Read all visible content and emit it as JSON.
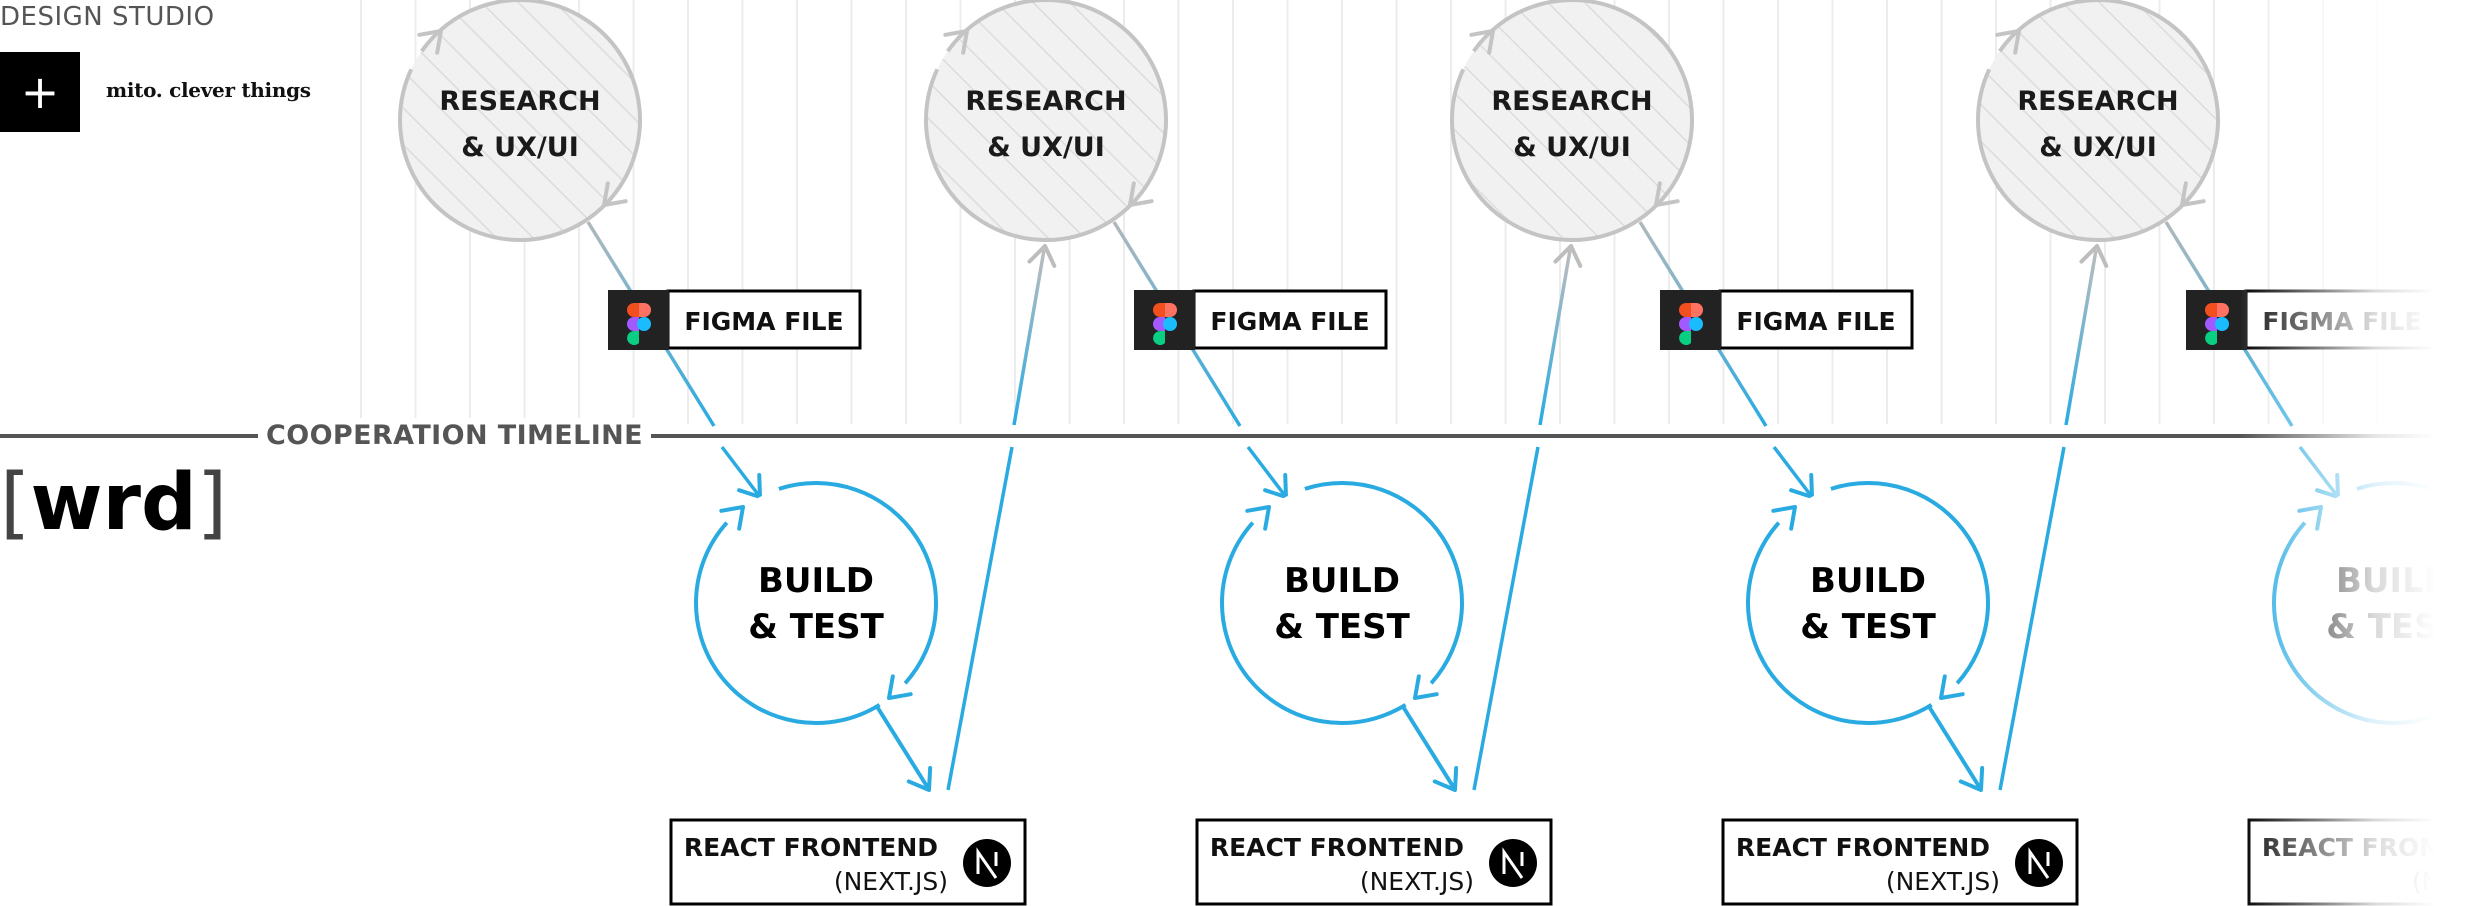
{
  "header": {
    "studio_label": "DESIGN STUDIO",
    "logo_icon": "plus-icon",
    "studio_name": "mito. clever things"
  },
  "client": {
    "bracket_left": "[",
    "name": "wrd",
    "bracket_right": "]"
  },
  "timeline": {
    "label": "COOPERATION TIMELINE",
    "arrow_icon": "arrow-right-icon"
  },
  "colors": {
    "research_stroke": "#c4c4c4",
    "research_fill": "#f1f1f1",
    "build_stroke": "#29abe2",
    "timeline": "#555555",
    "text_dark": "#1a1a1a"
  },
  "cycles": [
    {
      "research": {
        "line1": "RESEARCH",
        "line2": "& UX/UI"
      },
      "figma": {
        "label": "FIGMA FILE",
        "icon": "figma-icon"
      },
      "build": {
        "line1": "BUILD",
        "line2": "& TEST"
      },
      "react": {
        "line1": "REACT FRONTEND",
        "line2": "(NEXT.JS)",
        "icon": "nextjs-icon"
      }
    },
    {
      "research": {
        "line1": "RESEARCH",
        "line2": "& UX/UI"
      },
      "figma": {
        "label": "FIGMA FILE",
        "icon": "figma-icon"
      },
      "build": {
        "line1": "BUILD",
        "line2": "& TEST"
      },
      "react": {
        "line1": "REACT FRONTEND",
        "line2": "(NEXT.JS)",
        "icon": "nextjs-icon"
      }
    },
    {
      "research": {
        "line1": "RESEARCH",
        "line2": "& UX/UI"
      },
      "figma": {
        "label": "FIGMA FILE",
        "icon": "figma-icon"
      },
      "build": {
        "line1": "BUILD",
        "line2": "& TEST"
      },
      "react": {
        "line1": "REACT FRONTEND",
        "line2": "(NEXT.JS)",
        "icon": "nextjs-icon"
      }
    },
    {
      "research": {
        "line1": "RESEARCH",
        "line2": "& UX/UI"
      },
      "figma": {
        "label": "FIGMA FILE",
        "icon": "figma-icon"
      },
      "build": {
        "line1": "BUILD",
        "line2": "& TEST"
      },
      "react": {
        "line1": "REACT FRONTEND",
        "line2": "(NEXT.JS)",
        "icon": "nextjs-icon"
      }
    }
  ]
}
